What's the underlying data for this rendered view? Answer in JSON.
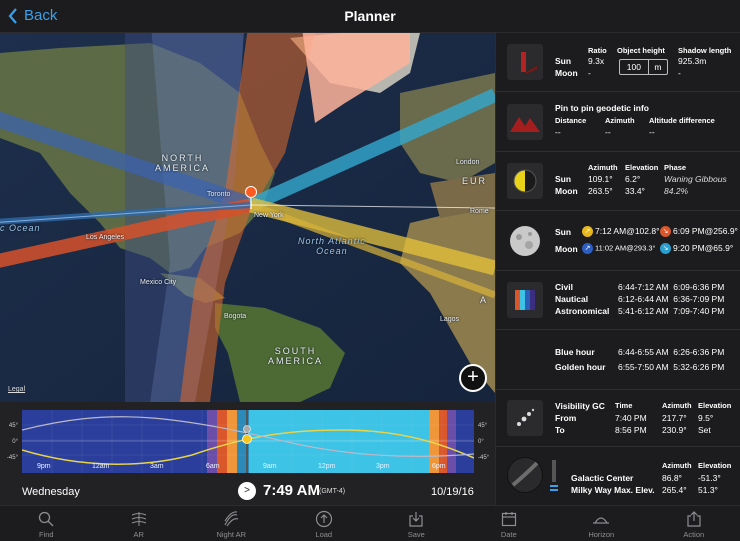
{
  "nav": {
    "back_label": "Back",
    "title": "Planner"
  },
  "map": {
    "labels": {
      "north_america": "NORTH\nAMERICA",
      "south_america": "SOUTH\nAMERICA",
      "europe": "EUR",
      "africa": "A",
      "north_atlantic": "North Atlantic\nOcean",
      "pacific": "c Ocean",
      "los_angeles": "Los Angeles",
      "mexico_city": "Mexico City",
      "bogota": "Bogota",
      "new_york": "New York",
      "london": "London",
      "rome": "Rome",
      "lagos": "Lagos",
      "toronto": "Toronto"
    },
    "legal": "Legal",
    "add_symbol": "+"
  },
  "timeline": {
    "axis_left": [
      "45°",
      "0°",
      "-45°"
    ],
    "axis_right": [
      "45°",
      "0°",
      "-45°"
    ],
    "hours": [
      "9pm",
      "12am",
      "3am",
      "6am",
      "9am",
      "12pm",
      "3pm",
      "6pm"
    ],
    "day": "Wednesday",
    "now_symbol": ">",
    "time": "7:49 AM",
    "tz": "(GMT-4)",
    "date": "10/19/16"
  },
  "panel": {
    "shadow": {
      "ratio_h": "Ratio",
      "height_h": "Object height",
      "shadow_h": "Shadow length",
      "sun": "Sun",
      "moon": "Moon",
      "ratio_sun": "9.3x",
      "ratio_moon": "-",
      "height_value": "100",
      "height_unit": "m",
      "shadow_sun": "925.3m",
      "shadow_moon": "-"
    },
    "geodetic": {
      "title": "Pin to pin geodetic info",
      "dist_h": "Distance",
      "az_h": "Azimuth",
      "alt_h": "Altitude difference",
      "dist": "--",
      "az": "--",
      "alt": "--"
    },
    "position": {
      "az_h": "Azimuth",
      "el_h": "Elevation",
      "phase_h": "Phase",
      "sun": "Sun",
      "moon": "Moon",
      "sun_az": "109.1°",
      "sun_el": "6.2°",
      "phase": "Waning Gibbous",
      "moon_az": "263.5°",
      "moon_el": "33.4°",
      "illum": "84.2%"
    },
    "rise_set": {
      "sun": "Sun",
      "moon": "Moon",
      "sun_rise": "7:12 AM@102.8°",
      "sun_set": "6:09 PM@256.9°",
      "moon_rise": "11:02 AM@293.3°",
      "moon_set": "9:20 PM@65.9°"
    },
    "twilight": {
      "civil": "Civil",
      "nautical": "Nautical",
      "astro": "Astronomical",
      "civil_v": "6:44-7:12 AM  6:09-6:36 PM",
      "nautical_v": "6:12-6:44 AM  6:36-7:09 PM",
      "astro_v": "5:41-6:12 AM  7:09-7:40 PM"
    },
    "hours": {
      "blue": "Blue hour",
      "golden": "Golden hour",
      "blue_v": "6:44-6:55 AM  6:26-6:36 PM",
      "golden_v": "6:55-7:50 AM  5:32-6:26 PM"
    },
    "visibility": {
      "title": "Visibility GC",
      "time_h": "Time",
      "az_h": "Azimuth",
      "el_h": "Elevation",
      "from": "From",
      "to": "To",
      "from_time": "7:40 PM",
      "from_az": "217.7°",
      "from_el": "9.5°",
      "to_time": "8:56 PM",
      "to_az": "230.9°",
      "to_el": "Set"
    },
    "galactic": {
      "az_h": "Azimuth",
      "el_h": "Elevation",
      "center": "Galactic Center",
      "mw": "Milky Way Max. Elev.",
      "center_az": "86.8°",
      "center_el": "-51.3°",
      "mw_az": "265.4°",
      "mw_el": "51.3°"
    }
  },
  "tabs": [
    {
      "label": "Find",
      "icon": "search-icon"
    },
    {
      "label": "AR",
      "icon": "ar-icon"
    },
    {
      "label": "Night AR",
      "icon": "night-ar-icon"
    },
    {
      "label": "Load",
      "icon": "load-icon"
    },
    {
      "label": "Save",
      "icon": "save-icon"
    },
    {
      "label": "Date",
      "icon": "calendar-icon"
    },
    {
      "label": "Horizon",
      "icon": "horizon-icon"
    },
    {
      "label": "Action",
      "icon": "share-icon"
    }
  ],
  "colors": {
    "accent": "#3aa0ea",
    "sun_line": "#e8c43a",
    "moon_line": "#3aa6c9",
    "pin": "#ff5a1f"
  }
}
